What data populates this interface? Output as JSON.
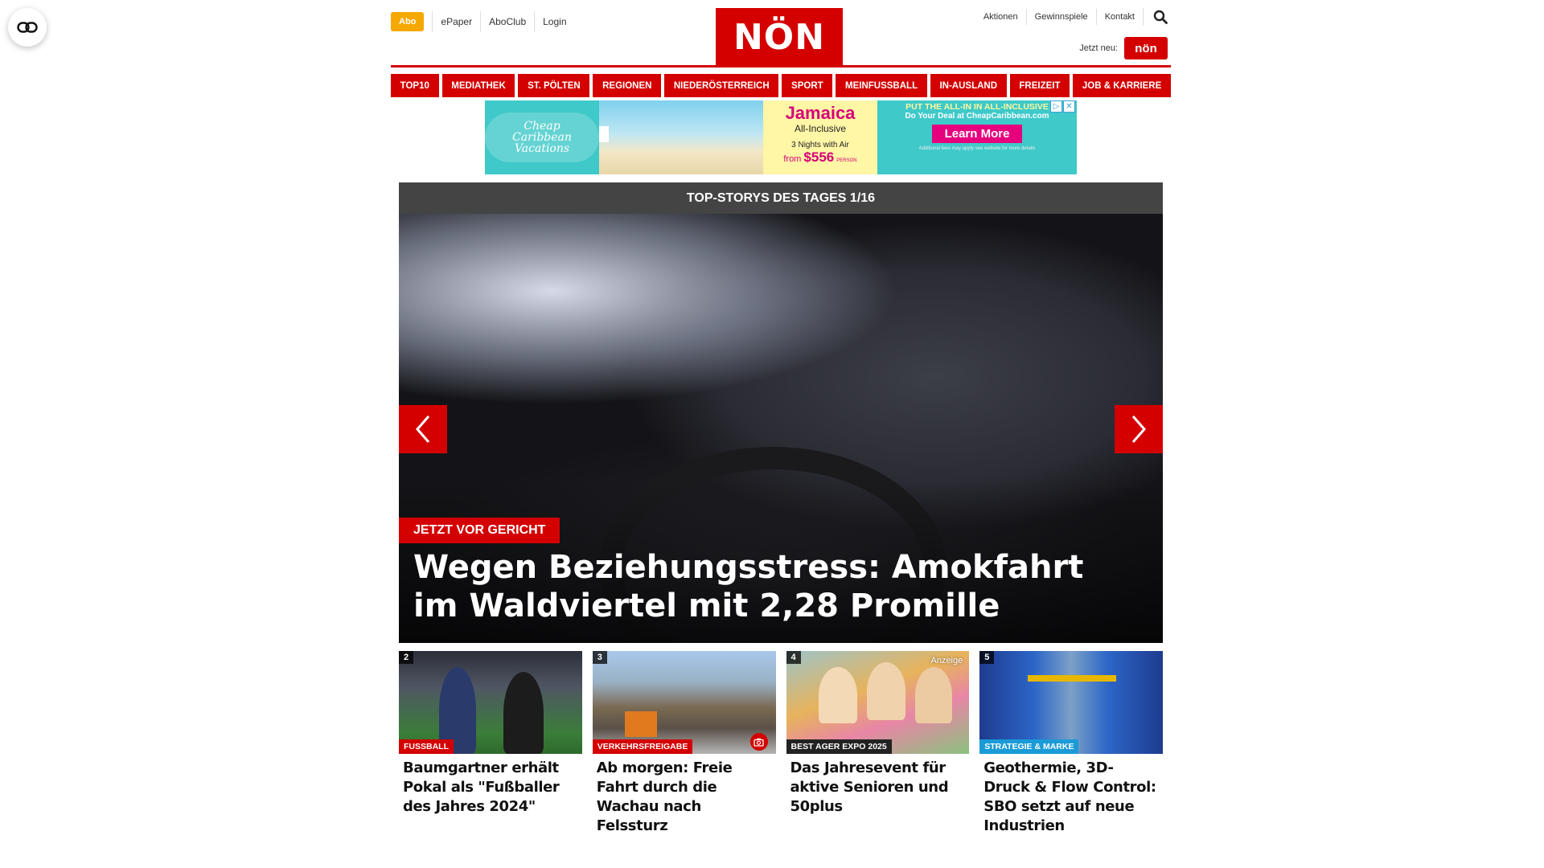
{
  "header": {
    "abo_label": "Abo",
    "left_links": [
      "ePaper",
      "AboClub",
      "Login"
    ],
    "logo_text": "NÖN",
    "right_links": [
      "Aktionen",
      "Gewinnspiele",
      "Kontakt"
    ],
    "search_icon": "search-icon",
    "jetzt_neu_label": "Jetzt neu:",
    "app_badge_text": "nön"
  },
  "nav": {
    "items": [
      "TOP10",
      "MEDIATHEK",
      "ST. PÖLTEN",
      "REGIONEN",
      "NIEDERÖSTERREICH",
      "SPORT",
      "MEINFUSSBALL",
      "IN-AUSLAND",
      "FREIZEIT",
      "JOB & KARRIERE"
    ]
  },
  "ad": {
    "brand": "Cheap Caribbean Vacations",
    "destination": "Jamaica",
    "package": "All-Inclusive",
    "nights": "3 Nights with Air",
    "price_prefix": "from",
    "price": "$556",
    "price_suffix": "PERSON",
    "headline": "PUT THE ALL-IN IN ALL-INCLUSIVE",
    "subline": "Do Your Deal at CheapCaribbean.com",
    "cta": "Learn More",
    "fine_print": "Additional fees may apply see website for more details"
  },
  "topstories": {
    "header": "TOP-STORYS DES TAGES 1/16",
    "hero": {
      "tag": "JETZT VOR GERICHT",
      "title": "Wegen Beziehungsstress: Amokfahrt im Waldviertel mit 2,28 Promille"
    },
    "teasers": [
      {
        "num": "2",
        "tag": "FUSSBALL",
        "title": "Baumgartner erhält Pokal als \"Fußballer des Jahres 2024\""
      },
      {
        "num": "3",
        "tag": "VERKEHRSFREIGABE",
        "title": "Ab morgen: Freie Fahrt durch die Wachau nach Felssturz"
      },
      {
        "num": "4",
        "tag": "BEST AGER EXPO 2025",
        "badge": "Anzeige",
        "title": "Das Jahresevent für aktive Senioren und 50plus"
      },
      {
        "num": "5",
        "tag": "STRATEGIE & MARKE",
        "title": "Geothermie, 3D-Druck & Flow Control: SBO setzt auf neue Industrien"
      }
    ]
  },
  "colors": {
    "brand_red": "#d40000",
    "abo_orange": "#f5a800",
    "header_gray": "#444444",
    "footer_blue": "#1b3a8f"
  }
}
